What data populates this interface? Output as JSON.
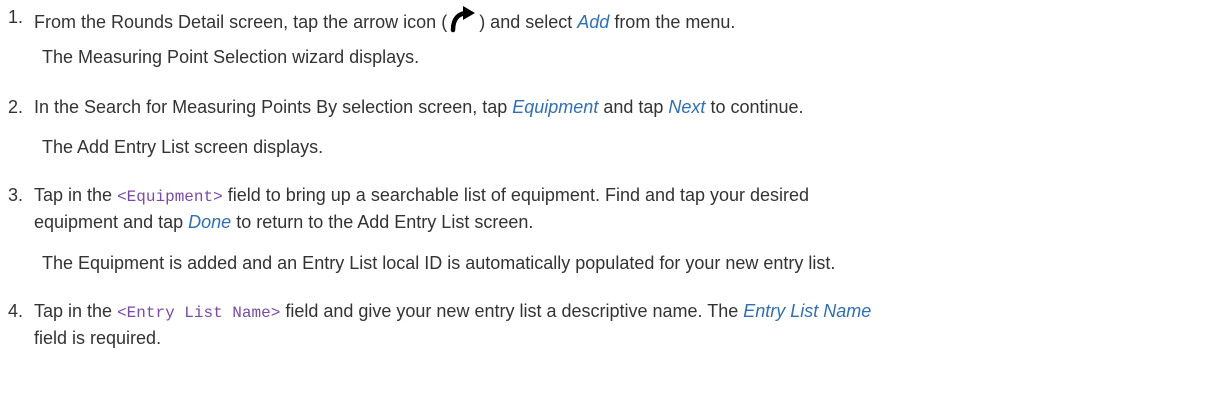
{
  "steps": [
    {
      "number": "1.",
      "line1_pre": "From the Rounds Detail screen, tap the arrow icon (",
      "line1_post": ") and select",
      "line1_kw": "Add",
      "line1_end": "from the menu.",
      "result": "The Measuring Point Selection wizard displays."
    },
    {
      "number": "2.",
      "line1_pre": "In the Search for Measuring Points By selection screen, tap",
      "kw1": "Equipment",
      "mid": "and tap",
      "kw2": "Next",
      "end": "to continue.",
      "result": "The Add Entry List screen displays."
    },
    {
      "number": "3.",
      "line1_pre": "Tap in the",
      "code": "<Equipment>",
      "line1_post": "field to bring up a searchable list of equipment. Find and tap your desired",
      "line2_pre": "equipment and tap",
      "kw": "Done",
      "line2_post": "to return to the Add Entry List screen.",
      "result": "The Equipment is added and an Entry List local ID is automatically populated for your new entry list."
    },
    {
      "number": "4.",
      "line1_pre": "Tap in the",
      "code": "<Entry List Name>",
      "line1_post": "field and give your new entry list a descriptive name. The",
      "kw": "Entry List Name",
      "line2": "field is required."
    }
  ],
  "icons": {
    "arrow": "curved-arrow-icon"
  }
}
